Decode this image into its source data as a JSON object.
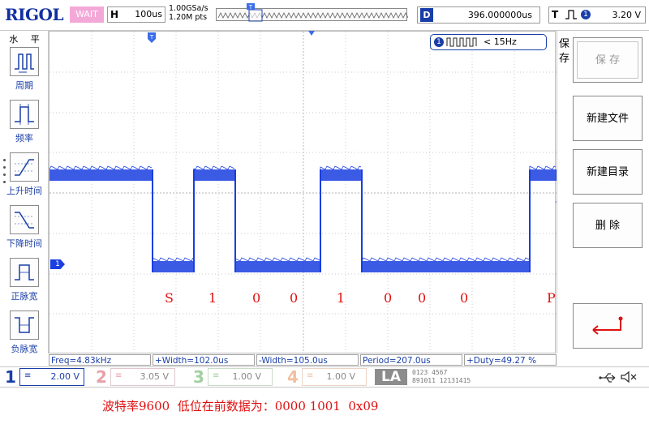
{
  "header": {
    "brand": "RIGOL",
    "run_status": "WAIT",
    "timebase_letter": "H",
    "timebase_value": "100us",
    "sample_rate": "1.00GSa/s",
    "memory_depth": "1.20M pts",
    "delay_letter": "D",
    "delay_value": "396.000000us",
    "trigger_letter": "T",
    "trigger_channel": "1",
    "trigger_level": "3.20 V"
  },
  "left_menu": {
    "title": "水 平",
    "items": [
      {
        "label": "周期",
        "icon": "period-icon"
      },
      {
        "label": "频率",
        "icon": "frequency-icon"
      },
      {
        "label": "上升时间",
        "icon": "rise-time-icon"
      },
      {
        "label": "下降时间",
        "icon": "fall-time-icon"
      },
      {
        "label": "正脉宽",
        "icon": "positive-width-icon"
      },
      {
        "label": "负脉宽",
        "icon": "negative-width-icon"
      }
    ]
  },
  "right_menu": {
    "title": "保存",
    "buttons": [
      {
        "label": "保 存",
        "enabled": false
      },
      {
        "label": "新建文件",
        "enabled": true
      },
      {
        "label": "新建目录",
        "enabled": true
      },
      {
        "label": "删 除",
        "enabled": true
      },
      {
        "label": "",
        "icon": "return-arrow-icon",
        "enabled": true
      }
    ]
  },
  "plot": {
    "counter_channel": "1",
    "counter_text": "< 15Hz",
    "channel_marker": "1",
    "bit_labels": [
      "S",
      "1",
      "0",
      "0",
      "1",
      "0",
      "0",
      "0",
      "P"
    ],
    "trace_color": "#1a3ee0"
  },
  "measurements": [
    "Freq=4.83kHz",
    "+Width=102.0us",
    "-Width=105.0us",
    "Period=207.0us",
    "+Duty=49.27 %"
  ],
  "channels": [
    {
      "num": "1",
      "coupling": "≡",
      "scale": "2.00 V",
      "color": "#1a3ea8",
      "active": true
    },
    {
      "num": "2",
      "coupling": "≡",
      "scale": "3.05 V",
      "color": "#e8a0a8",
      "active": false
    },
    {
      "num": "3",
      "coupling": "≡",
      "scale": "1.00 V",
      "color": "#a0d0a0",
      "active": false
    },
    {
      "num": "4",
      "coupling": "≡",
      "scale": "1.00 V",
      "color": "#f0c0a0",
      "active": false
    }
  ],
  "la_label": "LA",
  "la_bits_top": "0123 4567",
  "la_bits_bottom": "891011 12131415",
  "caption": "波特率9600  低位在前数据为：0000 1001  0x09",
  "colors": {
    "brand": "#1230a0",
    "accent": "#1a3ea8",
    "wait": "#f4a8d8",
    "annotation": "#e01010"
  }
}
